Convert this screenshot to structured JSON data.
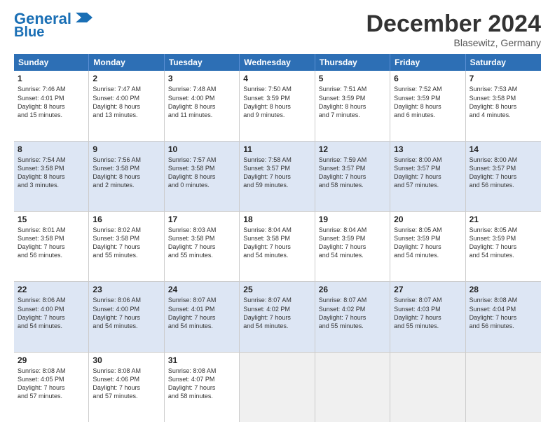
{
  "header": {
    "logo_line1": "General",
    "logo_line2": "Blue",
    "month_title": "December 2024",
    "location": "Blasewitz, Germany"
  },
  "weekdays": [
    "Sunday",
    "Monday",
    "Tuesday",
    "Wednesday",
    "Thursday",
    "Friday",
    "Saturday"
  ],
  "rows": [
    [
      {
        "day": "1",
        "lines": [
          "Sunrise: 7:46 AM",
          "Sunset: 4:01 PM",
          "Daylight: 8 hours",
          "and 15 minutes."
        ]
      },
      {
        "day": "2",
        "lines": [
          "Sunrise: 7:47 AM",
          "Sunset: 4:00 PM",
          "Daylight: 8 hours",
          "and 13 minutes."
        ]
      },
      {
        "day": "3",
        "lines": [
          "Sunrise: 7:48 AM",
          "Sunset: 4:00 PM",
          "Daylight: 8 hours",
          "and 11 minutes."
        ]
      },
      {
        "day": "4",
        "lines": [
          "Sunrise: 7:50 AM",
          "Sunset: 3:59 PM",
          "Daylight: 8 hours",
          "and 9 minutes."
        ]
      },
      {
        "day": "5",
        "lines": [
          "Sunrise: 7:51 AM",
          "Sunset: 3:59 PM",
          "Daylight: 8 hours",
          "and 7 minutes."
        ]
      },
      {
        "day": "6",
        "lines": [
          "Sunrise: 7:52 AM",
          "Sunset: 3:59 PM",
          "Daylight: 8 hours",
          "and 6 minutes."
        ]
      },
      {
        "day": "7",
        "lines": [
          "Sunrise: 7:53 AM",
          "Sunset: 3:58 PM",
          "Daylight: 8 hours",
          "and 4 minutes."
        ]
      }
    ],
    [
      {
        "day": "8",
        "lines": [
          "Sunrise: 7:54 AM",
          "Sunset: 3:58 PM",
          "Daylight: 8 hours",
          "and 3 minutes."
        ]
      },
      {
        "day": "9",
        "lines": [
          "Sunrise: 7:56 AM",
          "Sunset: 3:58 PM",
          "Daylight: 8 hours",
          "and 2 minutes."
        ]
      },
      {
        "day": "10",
        "lines": [
          "Sunrise: 7:57 AM",
          "Sunset: 3:58 PM",
          "Daylight: 8 hours",
          "and 0 minutes."
        ]
      },
      {
        "day": "11",
        "lines": [
          "Sunrise: 7:58 AM",
          "Sunset: 3:57 PM",
          "Daylight: 7 hours",
          "and 59 minutes."
        ]
      },
      {
        "day": "12",
        "lines": [
          "Sunrise: 7:59 AM",
          "Sunset: 3:57 PM",
          "Daylight: 7 hours",
          "and 58 minutes."
        ]
      },
      {
        "day": "13",
        "lines": [
          "Sunrise: 8:00 AM",
          "Sunset: 3:57 PM",
          "Daylight: 7 hours",
          "and 57 minutes."
        ]
      },
      {
        "day": "14",
        "lines": [
          "Sunrise: 8:00 AM",
          "Sunset: 3:57 PM",
          "Daylight: 7 hours",
          "and 56 minutes."
        ]
      }
    ],
    [
      {
        "day": "15",
        "lines": [
          "Sunrise: 8:01 AM",
          "Sunset: 3:58 PM",
          "Daylight: 7 hours",
          "and 56 minutes."
        ]
      },
      {
        "day": "16",
        "lines": [
          "Sunrise: 8:02 AM",
          "Sunset: 3:58 PM",
          "Daylight: 7 hours",
          "and 55 minutes."
        ]
      },
      {
        "day": "17",
        "lines": [
          "Sunrise: 8:03 AM",
          "Sunset: 3:58 PM",
          "Daylight: 7 hours",
          "and 55 minutes."
        ]
      },
      {
        "day": "18",
        "lines": [
          "Sunrise: 8:04 AM",
          "Sunset: 3:58 PM",
          "Daylight: 7 hours",
          "and 54 minutes."
        ]
      },
      {
        "day": "19",
        "lines": [
          "Sunrise: 8:04 AM",
          "Sunset: 3:59 PM",
          "Daylight: 7 hours",
          "and 54 minutes."
        ]
      },
      {
        "day": "20",
        "lines": [
          "Sunrise: 8:05 AM",
          "Sunset: 3:59 PM",
          "Daylight: 7 hours",
          "and 54 minutes."
        ]
      },
      {
        "day": "21",
        "lines": [
          "Sunrise: 8:05 AM",
          "Sunset: 3:59 PM",
          "Daylight: 7 hours",
          "and 54 minutes."
        ]
      }
    ],
    [
      {
        "day": "22",
        "lines": [
          "Sunrise: 8:06 AM",
          "Sunset: 4:00 PM",
          "Daylight: 7 hours",
          "and 54 minutes."
        ]
      },
      {
        "day": "23",
        "lines": [
          "Sunrise: 8:06 AM",
          "Sunset: 4:00 PM",
          "Daylight: 7 hours",
          "and 54 minutes."
        ]
      },
      {
        "day": "24",
        "lines": [
          "Sunrise: 8:07 AM",
          "Sunset: 4:01 PM",
          "Daylight: 7 hours",
          "and 54 minutes."
        ]
      },
      {
        "day": "25",
        "lines": [
          "Sunrise: 8:07 AM",
          "Sunset: 4:02 PM",
          "Daylight: 7 hours",
          "and 54 minutes."
        ]
      },
      {
        "day": "26",
        "lines": [
          "Sunrise: 8:07 AM",
          "Sunset: 4:02 PM",
          "Daylight: 7 hours",
          "and 55 minutes."
        ]
      },
      {
        "day": "27",
        "lines": [
          "Sunrise: 8:07 AM",
          "Sunset: 4:03 PM",
          "Daylight: 7 hours",
          "and 55 minutes."
        ]
      },
      {
        "day": "28",
        "lines": [
          "Sunrise: 8:08 AM",
          "Sunset: 4:04 PM",
          "Daylight: 7 hours",
          "and 56 minutes."
        ]
      }
    ],
    [
      {
        "day": "29",
        "lines": [
          "Sunrise: 8:08 AM",
          "Sunset: 4:05 PM",
          "Daylight: 7 hours",
          "and 57 minutes."
        ]
      },
      {
        "day": "30",
        "lines": [
          "Sunrise: 8:08 AM",
          "Sunset: 4:06 PM",
          "Daylight: 7 hours",
          "and 57 minutes."
        ]
      },
      {
        "day": "31",
        "lines": [
          "Sunrise: 8:08 AM",
          "Sunset: 4:07 PM",
          "Daylight: 7 hours",
          "and 58 minutes."
        ]
      },
      {
        "day": "",
        "lines": []
      },
      {
        "day": "",
        "lines": []
      },
      {
        "day": "",
        "lines": []
      },
      {
        "day": "",
        "lines": []
      }
    ]
  ]
}
